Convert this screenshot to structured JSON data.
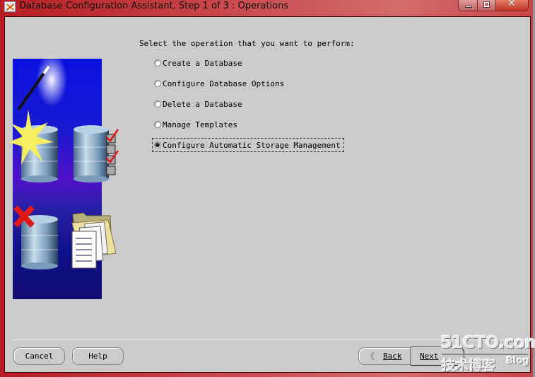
{
  "window": {
    "title": "Database Configuration Assistant, Step 1 of 3 : Operations",
    "controls": {
      "minimize": "minimize",
      "maximize": "maximize",
      "close": "close"
    }
  },
  "main": {
    "prompt": "Select the operation that you want to perform:",
    "options": [
      {
        "label": "Create a Database",
        "selected": false
      },
      {
        "label": "Configure Database Options",
        "selected": false
      },
      {
        "label": "Delete a Database",
        "selected": false
      },
      {
        "label": "Manage Templates",
        "selected": false
      },
      {
        "label": "Configure Automatic Storage Management",
        "selected": true
      }
    ],
    "selected_option": "Configure Automatic Storage Management"
  },
  "footer": {
    "cancel_label": "Cancel",
    "help_label": "Help",
    "back_label": "Back",
    "next_label": "Next"
  },
  "watermark": {
    "brand": "51CTO.com",
    "subtitle": "技术博客",
    "blog": "Blog"
  },
  "icons": {
    "app": "oracle-dbca-icon",
    "wizard_image": "database-wizard-illustration"
  },
  "colors": {
    "titlebar": "#c94b50",
    "client_bg": "#cbcbcb",
    "image_bg": "#1a1ad0"
  }
}
